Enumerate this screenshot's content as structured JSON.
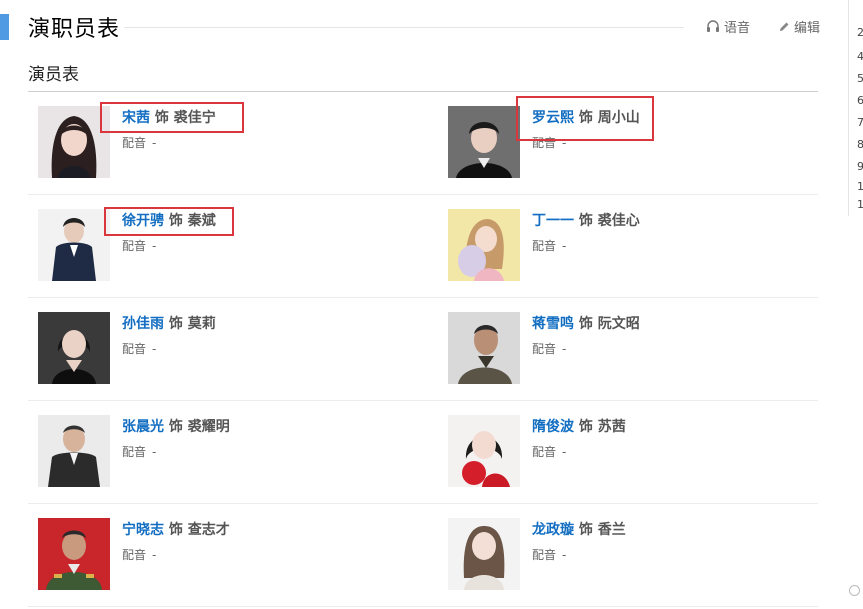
{
  "header": {
    "title": "演职员表",
    "voice_label": "语音",
    "edit_label": "编辑"
  },
  "section": {
    "title": "演员表"
  },
  "cast_rows": [
    [
      {
        "actor": "宋茜",
        "shi": "饰",
        "role": "裘佳宁",
        "voice_label": "配音",
        "voice_value": "-",
        "highlighted": true
      },
      {
        "actor": "罗云熙",
        "shi": "饰",
        "role": "周小山",
        "voice_label": "配音",
        "voice_value": "-",
        "highlighted": true
      }
    ],
    [
      {
        "actor": "徐开骋",
        "shi": "饰",
        "role": "秦斌",
        "voice_label": "配音",
        "voice_value": "-",
        "highlighted": true
      },
      {
        "actor": "丁一一",
        "shi": "饰",
        "role": "裘佳心",
        "voice_label": "配音",
        "voice_value": "-",
        "highlighted": false
      }
    ],
    [
      {
        "actor": "孙佳雨",
        "shi": "饰",
        "role": "莫莉",
        "voice_label": "配音",
        "voice_value": "-",
        "highlighted": false
      },
      {
        "actor": "蒋雪鸣",
        "shi": "饰",
        "role": "阮文昭",
        "voice_label": "配音",
        "voice_value": "-",
        "highlighted": false
      }
    ],
    [
      {
        "actor": "张晨光",
        "shi": "饰",
        "role": "裘耀明",
        "voice_label": "配音",
        "voice_value": "-",
        "highlighted": false
      },
      {
        "actor": "隋俊波",
        "shi": "饰",
        "role": "苏茜",
        "voice_label": "配音",
        "voice_value": "-",
        "highlighted": false
      }
    ],
    [
      {
        "actor": "宁晓志",
        "shi": "饰",
        "role": "查志才",
        "voice_label": "配音",
        "voice_value": "-",
        "highlighted": false
      },
      {
        "actor": "龙政璇",
        "shi": "饰",
        "role": "香兰",
        "voice_label": "配音",
        "voice_value": "-",
        "highlighted": false
      }
    ]
  ],
  "side_panel_chars": [
    "2",
    "4",
    "5",
    "6",
    "7",
    "8",
    "9",
    "1",
    "1"
  ],
  "colors": {
    "accent": "#4f9ae3",
    "link": "#136ec2",
    "highlight_box": "#d9363e"
  },
  "icons": {
    "voice": "headphones-icon",
    "edit": "pencil-icon"
  }
}
